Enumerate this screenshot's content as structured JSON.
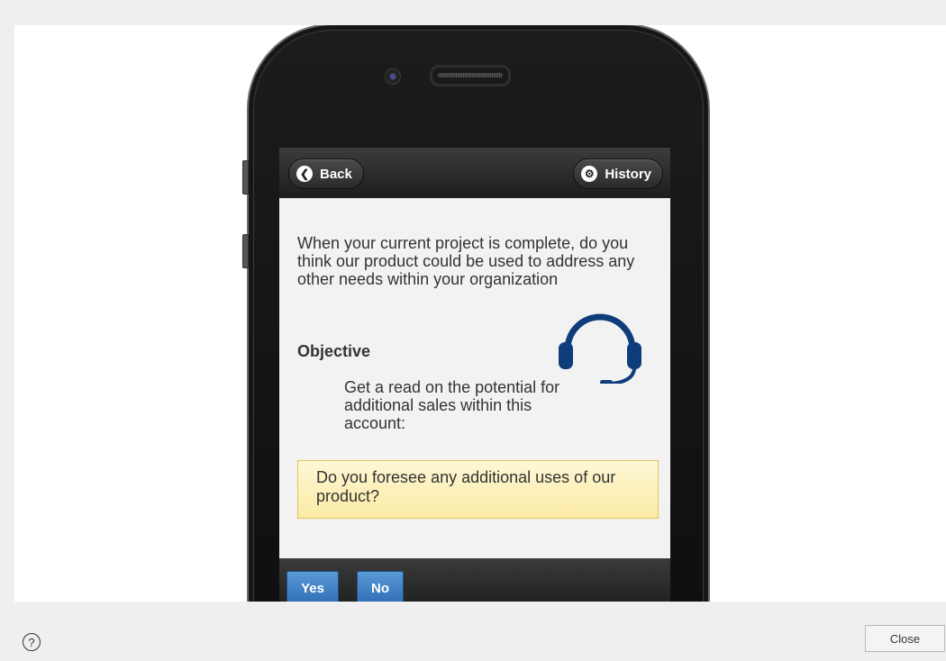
{
  "app": {
    "header": {
      "back_label": "Back",
      "history_label": "History"
    },
    "content": {
      "question": "When your current project is complete, do you think our product could be used to address any other needs within your organization",
      "objective_label": "Objective",
      "objective_text": "Get a read on the potential for additional sales within this account:",
      "prompt": "Do you foresee any additional uses of our product?",
      "illustration_icon": "headset-icon",
      "accent_color": "#0f3c7a"
    },
    "footer": {
      "yes_label": "Yes",
      "no_label": "No"
    }
  },
  "dialog": {
    "help_glyph": "?",
    "close_label": "Close"
  }
}
